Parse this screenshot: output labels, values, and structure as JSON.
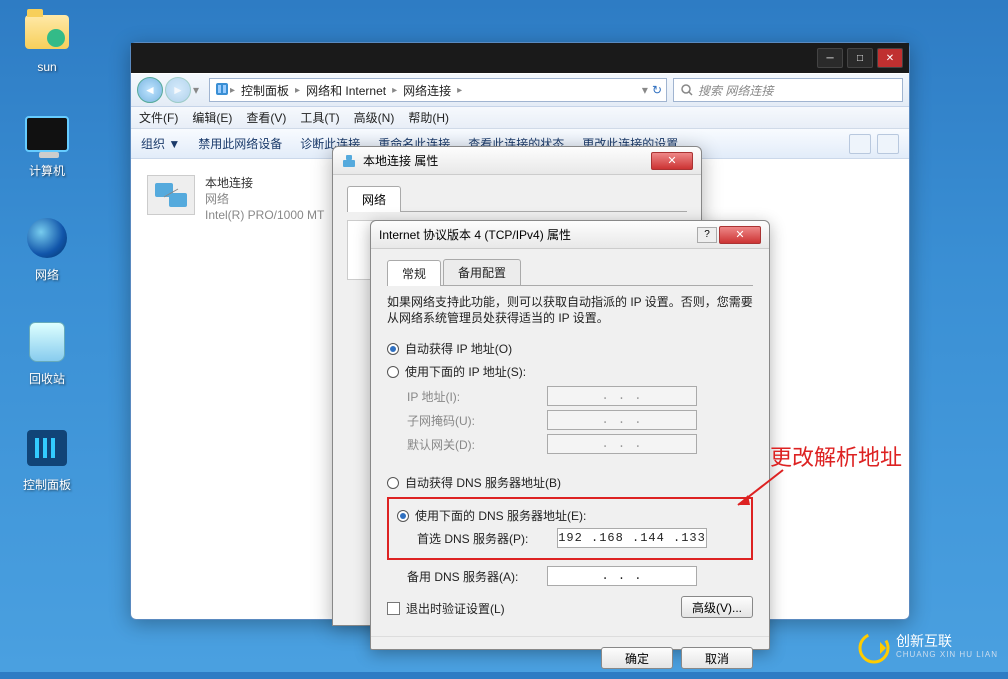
{
  "desktop": {
    "icons": [
      {
        "label": "sun"
      },
      {
        "label": "计算机"
      },
      {
        "label": "网络"
      },
      {
        "label": "回收站"
      },
      {
        "label": "控制面板"
      }
    ]
  },
  "explorer": {
    "breadcrumb": {
      "seg1": "控制面板",
      "seg2": "网络和 Internet",
      "seg3": "网络连接"
    },
    "search_placeholder": "搜索 网络连接",
    "menu": {
      "file": "文件(F)",
      "edit": "编辑(E)",
      "view": "查看(V)",
      "tools": "工具(T)",
      "adv": "高级(N)",
      "help": "帮助(H)"
    },
    "toolbar": {
      "org": "组织 ▼",
      "disable": "禁用此网络设备",
      "diag": "诊断此连接",
      "rename": "重命名此连接",
      "status": "查看此连接的状态",
      "change": "更改此连接的设置"
    },
    "connection": {
      "name": "本地连接",
      "net": "网络",
      "adapter": "Intel(R) PRO/1000 MT"
    }
  },
  "prop_dialog": {
    "title": "本地连接 属性",
    "tab": "网络"
  },
  "ipv4": {
    "title": "Internet 协议版本 4 (TCP/IPv4) 属性",
    "tab1": "常规",
    "tab2": "备用配置",
    "desc": "如果网络支持此功能，则可以获取自动指派的 IP 设置。否则，您需要从网络系统管理员处获得适当的 IP 设置。",
    "auto_ip": "自动获得 IP 地址(O)",
    "manual_ip": "使用下面的 IP 地址(S):",
    "ip_addr": "IP 地址(I):",
    "subnet": "子网掩码(U):",
    "gateway": "默认网关(D):",
    "auto_dns": "自动获得 DNS 服务器地址(B)",
    "manual_dns": "使用下面的 DNS 服务器地址(E):",
    "pref_dns": "首选 DNS 服务器(P):",
    "pref_dns_val": "192 .168 .144 .133",
    "alt_dns": "备用 DNS 服务器(A):",
    "alt_dns_val": " .   .   . ",
    "validate": "退出时验证设置(L)",
    "advanced": "高级(V)...",
    "ok": "确定",
    "cancel": "取消",
    "blank_ip": " .   .   . "
  },
  "annotation": "更改解析地址",
  "logo": {
    "name": "创新互联",
    "sub": "CHUANG XIN HU LIAN"
  }
}
